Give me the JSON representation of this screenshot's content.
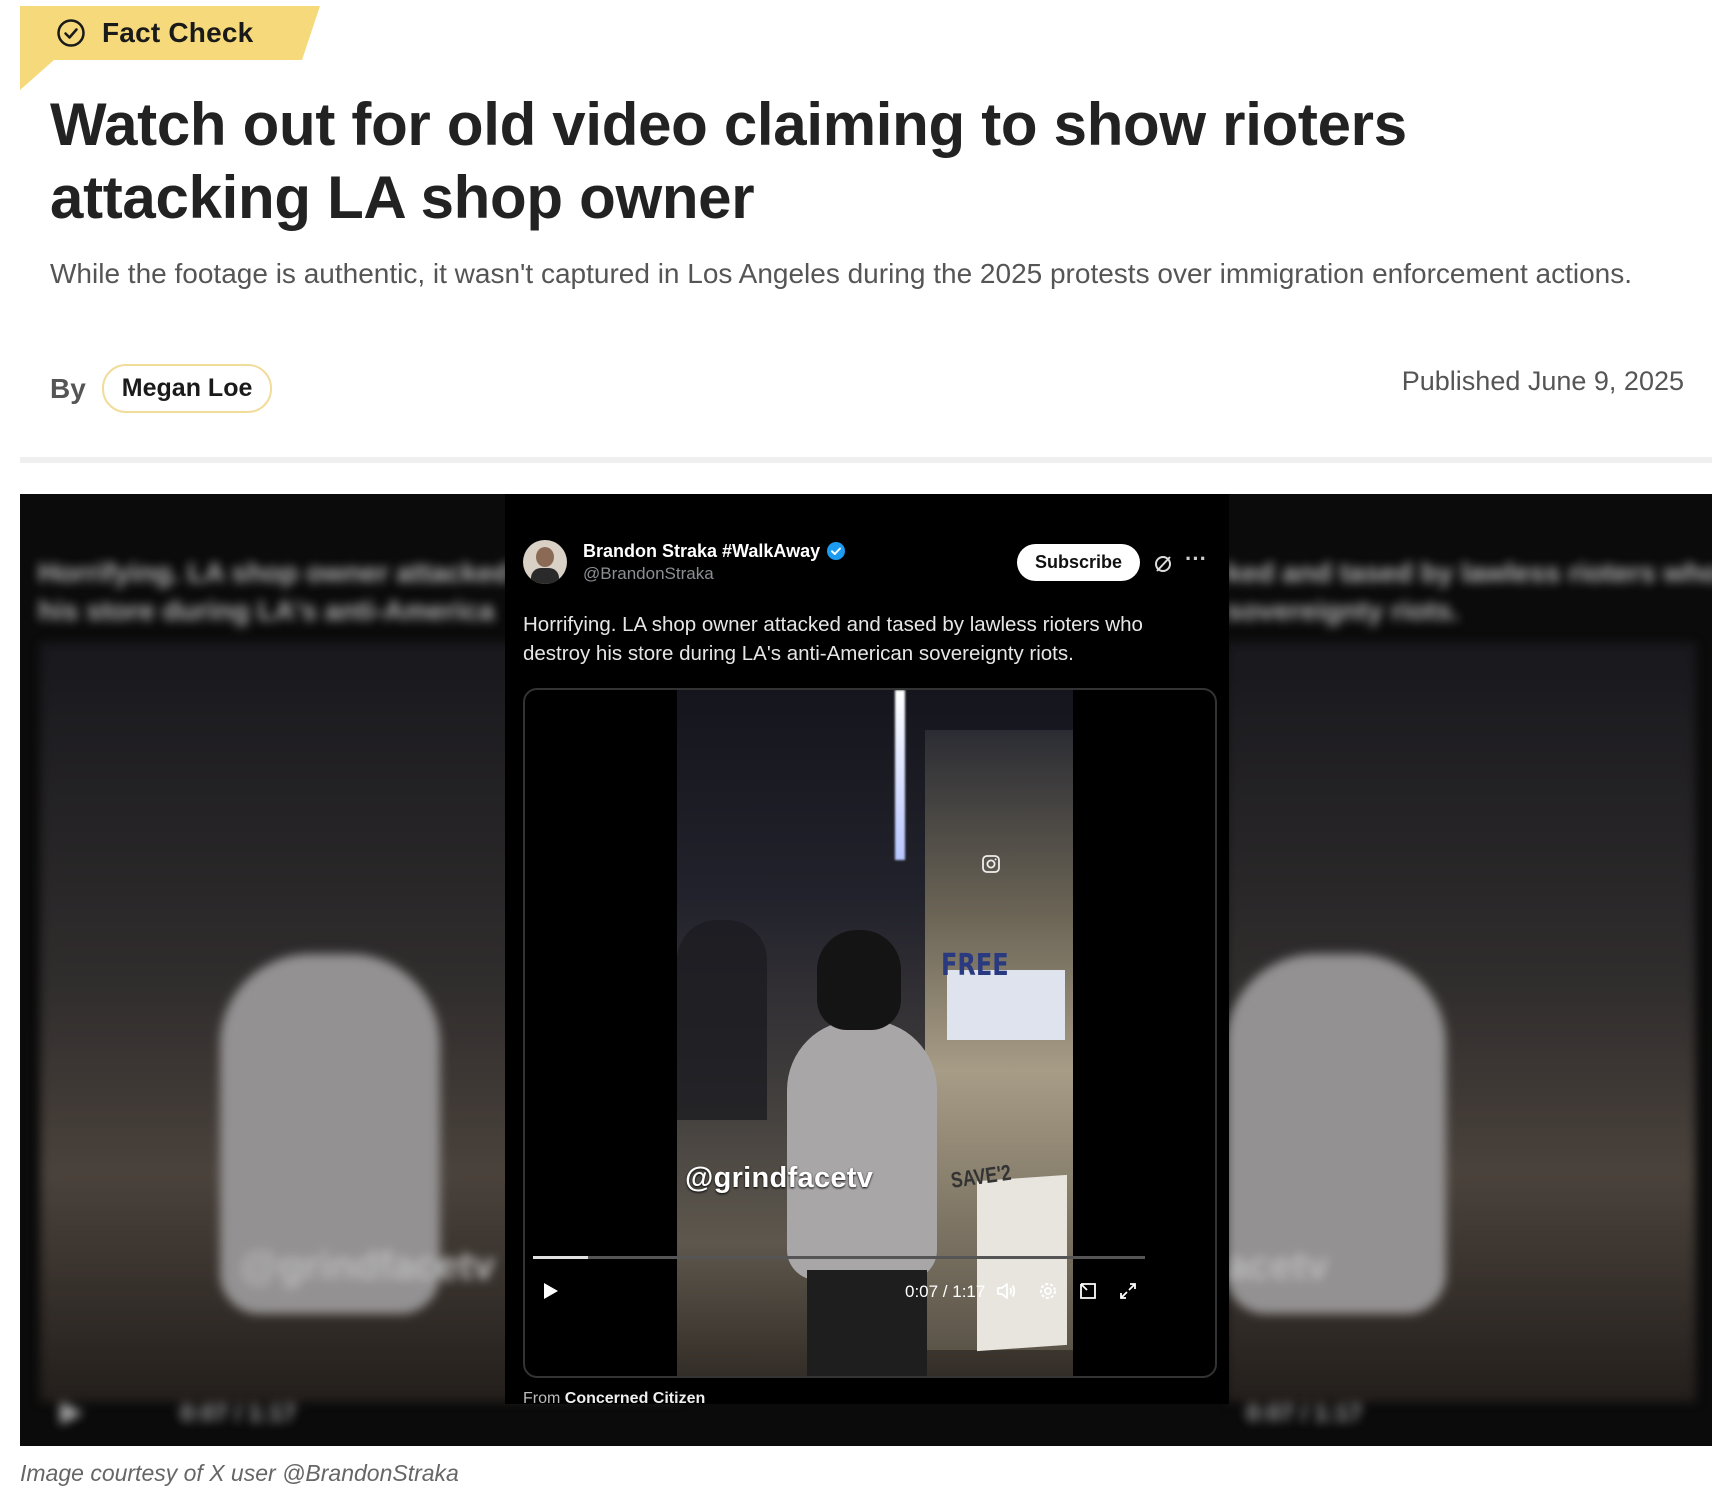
{
  "badge": {
    "label": "Fact Check",
    "icon": "check-circle-icon",
    "color": "#f5d97a"
  },
  "headline": "Watch out for old video claiming to show rioters attacking LA shop owner",
  "dek": "While the footage is authentic, it wasn't captured in Los Angeles during the 2025 protests over immigration enforcement actions.",
  "byline": {
    "by_label": "By",
    "author": "Megan Loe",
    "published": "Published June 9, 2025"
  },
  "embed": {
    "user_name": "Brandon Straka #WalkAway",
    "user_handle": "@BrandonStraka",
    "subscribe_label": "Subscribe",
    "more_label": "···",
    "tweet_text": "Horrifying. LA shop owner attacked and tased by lawless rioters who destroy his store during LA's anti-American sovereignty riots.",
    "video": {
      "watermark": "@grindfacetv",
      "poster_text_1": "FREE",
      "poster_text_2": "SAVE'2",
      "time": "0:07 / 1:17",
      "progress_fraction": 0.09
    },
    "from_prefix": "From",
    "from_user": "Concerned Citizen"
  },
  "background_blur": {
    "left_text": "Horrifying. LA shop owner attacked and ta destroy his store during LA's anti-America",
    "right_text": "ked and tased by lawless rioters who I-American sovereignty riots.",
    "left_watermark": "@grindfacetv",
    "right_watermark": "acetv",
    "left_time": "0:07 / 1:17",
    "right_time": "0:07 / 1:17"
  },
  "caption": "Image courtesy of X user @BrandonStraka",
  "colors": {
    "accent": "#f5d97a",
    "verified": "#1d9bf0"
  }
}
